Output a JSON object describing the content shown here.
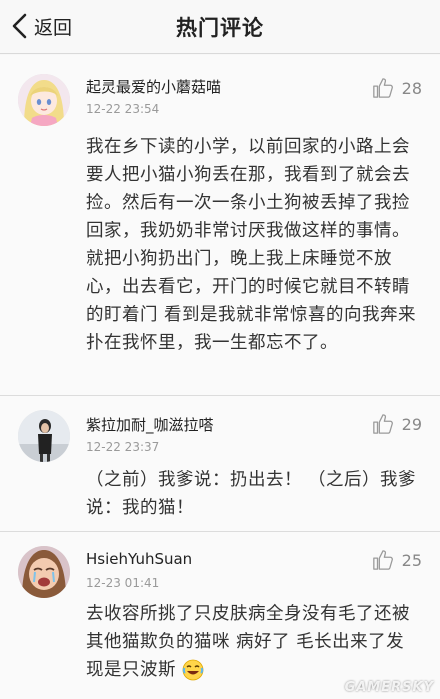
{
  "header": {
    "back_label": "返回",
    "title": "热门评论"
  },
  "comments": [
    {
      "username": "起灵最爱的小蘑菇喵",
      "time": "12-22 23:54",
      "likes": "28",
      "avatar_icon": "anime-girl-avatar",
      "text": "我在乡下读的小学，以前回家的小路上会要人把小猫小狗丢在那，我看到了就会去捡。然后有一次一条小土狗被丢掉了我捡回家，我奶奶非常讨厌我做这样的事情。就把小狗扔出门，晚上我上床睡觉不放心，出去看它，开门的时候它就目不转睛的盯着门 看到是我就非常惊喜的向我奔来扑在我怀里，我一生都忘不了。"
    },
    {
      "username": "紫拉加耐_咖滋拉嗒",
      "time": "12-22 23:37",
      "likes": "29",
      "avatar_icon": "photo-avatar",
      "text": "（之前）我爹说：扔出去！ （之后）我爹说：我的猫！"
    },
    {
      "username": "HsiehYuhSuan",
      "time": "12-23 01:41",
      "likes": "25",
      "avatar_icon": "cartoon-crying-avatar",
      "text": "去收容所挑了只皮肤病全身没有毛了还被其他猫欺负的猫咪 病好了 毛长出来了发现是只波斯",
      "trailing_emoji": "laughing-crying-emoji"
    }
  ],
  "watermark": "GAMERSKY"
}
